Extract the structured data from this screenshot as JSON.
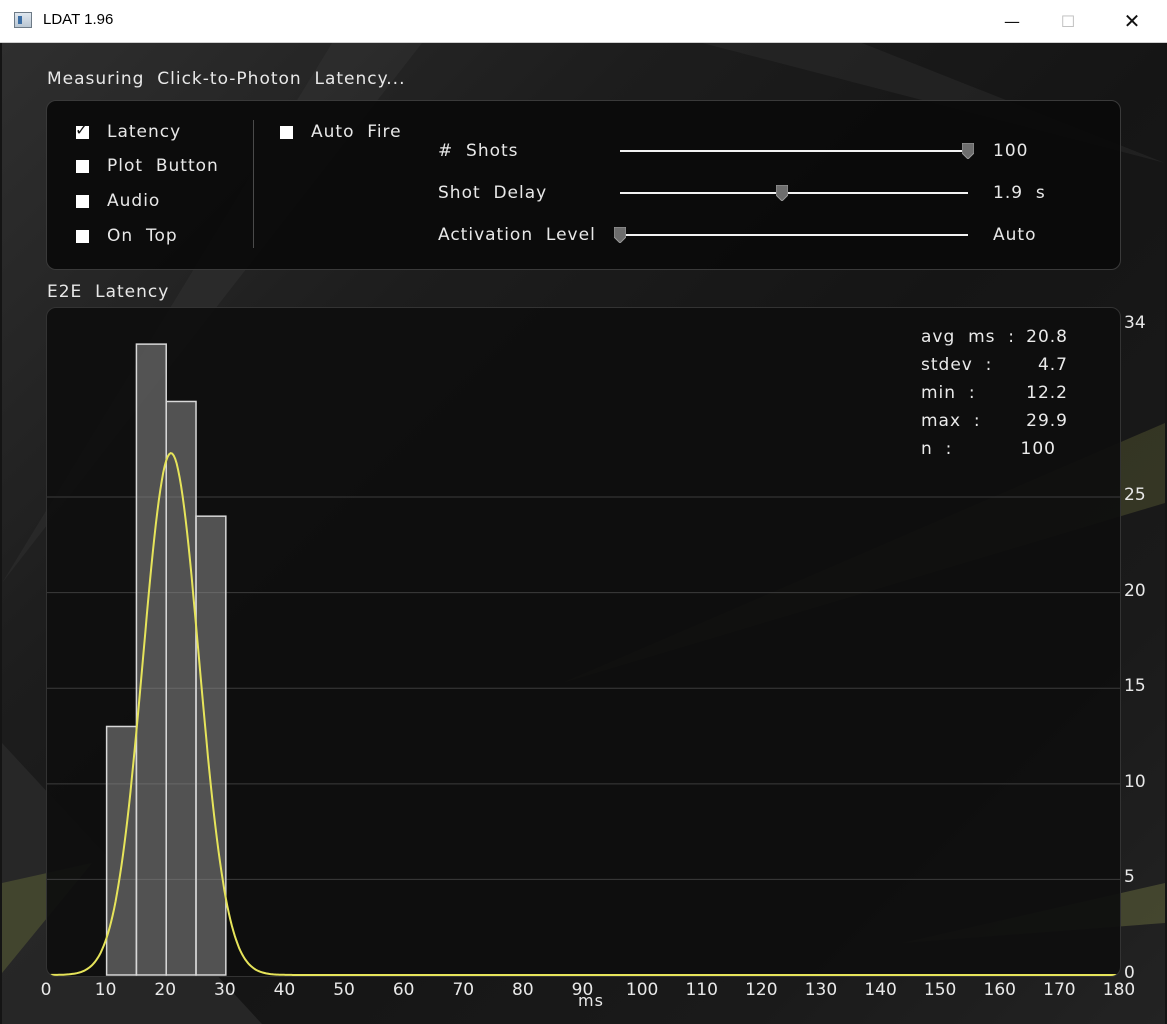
{
  "window": {
    "title": "LDAT 1.96"
  },
  "window_controls": {
    "minimize": "—",
    "maximize": "☐",
    "close": "✕"
  },
  "header": {
    "status": "Measuring  Click-to-Photon  Latency..."
  },
  "options": {
    "latency": {
      "label": "Latency",
      "checked": true
    },
    "plot_button": {
      "label": "Plot  Button",
      "checked": false
    },
    "audio": {
      "label": "Audio",
      "checked": false
    },
    "on_top": {
      "label": "On  Top",
      "checked": false
    },
    "auto_fire": {
      "label": "Auto  Fire",
      "checked": false
    }
  },
  "sliders": {
    "shots": {
      "label": "#  Shots",
      "value": "100",
      "level": 1.0
    },
    "shot_delay": {
      "label": "Shot  Delay",
      "value": "1.9  s",
      "level": 0.465
    },
    "activation_level": {
      "label": "Activation  Level",
      "value": "Auto",
      "level": 0.0
    }
  },
  "plot": {
    "title": "E2E  Latency",
    "xlabel": "ms"
  },
  "stats": {
    "avg": {
      "label": "avg  ms  :",
      "value": "20.8"
    },
    "stdev": {
      "label": "stdev  :",
      "value": "4.7"
    },
    "min": {
      "label": "min  :",
      "value": "12.2"
    },
    "max": {
      "label": "max  :",
      "value": "29.9"
    },
    "n": {
      "label": "n  :",
      "value": "100"
    }
  },
  "colors": {
    "curve": "#e6e45a",
    "bar_fill": "#8a8a8a",
    "bar_stroke": "#d8d8d8",
    "grid": "#3c3c3c"
  },
  "chart_data": {
    "type": "bar",
    "title": "E2E  Latency",
    "xlabel": "ms",
    "ylabel": "",
    "xlim": [
      0,
      180
    ],
    "ylim": [
      0,
      34
    ],
    "x_ticks": [
      0,
      10,
      20,
      30,
      40,
      50,
      60,
      70,
      80,
      90,
      100,
      110,
      120,
      130,
      140,
      150,
      160,
      170,
      180
    ],
    "y_ticks": [
      0,
      5,
      10,
      15,
      20,
      25,
      34
    ],
    "bins": [
      {
        "start": 10,
        "end": 15,
        "count": 13
      },
      {
        "start": 15,
        "end": 20,
        "count": 33
      },
      {
        "start": 20,
        "end": 25,
        "count": 30
      },
      {
        "start": 25,
        "end": 30,
        "count": 24
      }
    ],
    "curve": {
      "type": "normal",
      "mean": 20.8,
      "stdev": 4.7,
      "peak": 27.3
    },
    "grid": true
  }
}
